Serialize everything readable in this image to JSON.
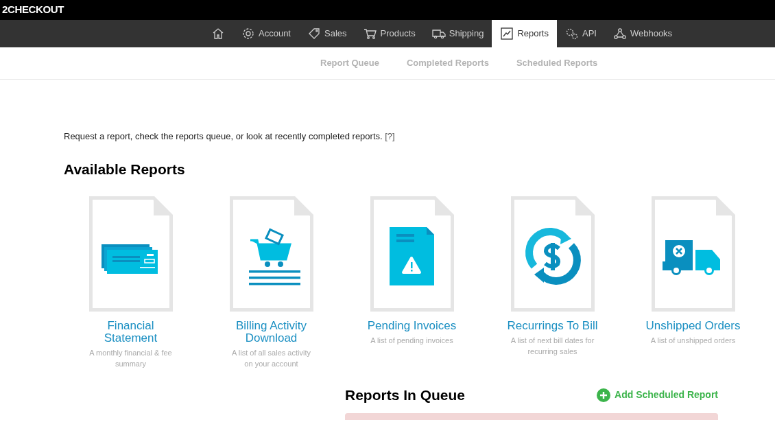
{
  "brand": "2CHECKOUT",
  "nav": [
    {
      "selected": false
    },
    {
      "label": "Account",
      "selected": false
    },
    {
      "label": "Sales",
      "selected": false
    },
    {
      "label": "Products",
      "selected": false
    },
    {
      "label": "Shipping",
      "selected": false
    },
    {
      "label": "Reports",
      "selected": true
    },
    {
      "label": "API",
      "selected": false
    },
    {
      "label": "Webhooks",
      "selected": false
    }
  ],
  "subnav": [
    "Report Queue",
    "Completed Reports",
    "Scheduled Reports"
  ],
  "intro": {
    "text": "Request a report, check the reports queue, or look at recently completed reports.",
    "help_link": "[?]"
  },
  "available_reports": {
    "title": "Available Reports",
    "items": [
      {
        "title": "Financial Statement",
        "description": "A monthly financial & fee summary"
      },
      {
        "title": "Billing Activity Download",
        "description": "A list of all sales activity on your account"
      },
      {
        "title": "Pending Invoices",
        "description": "A list of pending invoices"
      },
      {
        "title": "Recurrings To Bill",
        "description": "A list of next bill dates for recurring sales"
      },
      {
        "title": "Unshipped Orders",
        "description": "A list of unshipped orders"
      }
    ]
  },
  "queue": {
    "title": "Reports In Queue",
    "add_button": "Add Scheduled Report"
  }
}
